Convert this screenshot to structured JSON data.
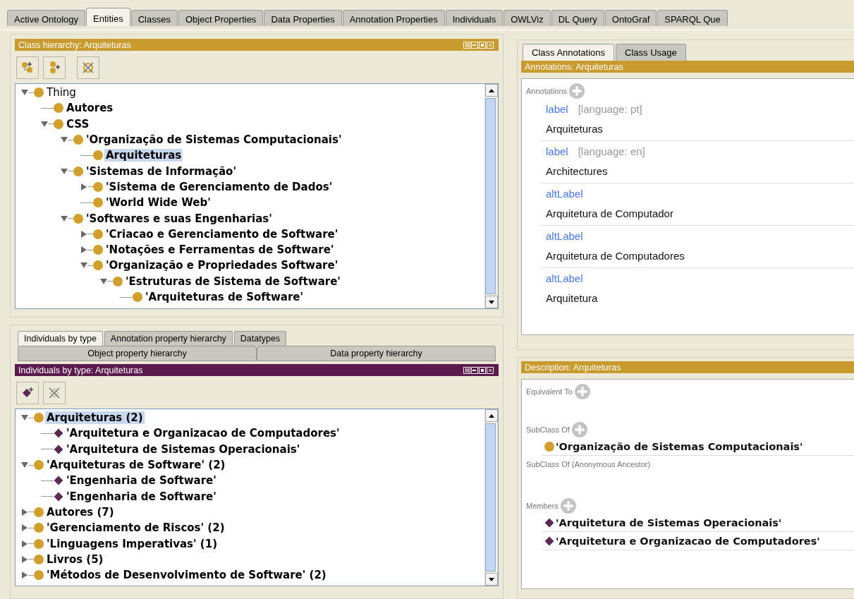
{
  "main_tabs": [
    {
      "label": "Active Ontology",
      "selected": false
    },
    {
      "label": "Entities",
      "selected": true
    },
    {
      "label": "Classes",
      "selected": false
    },
    {
      "label": "Object Properties",
      "selected": false
    },
    {
      "label": "Data Properties",
      "selected": false
    },
    {
      "label": "Annotation Properties",
      "selected": false
    },
    {
      "label": "Individuals",
      "selected": false
    },
    {
      "label": "OWLViz",
      "selected": false
    },
    {
      "label": "DL Query",
      "selected": false
    },
    {
      "label": "OntoGraf",
      "selected": false
    },
    {
      "label": "SPARQL Que",
      "selected": false
    }
  ],
  "class_hierarchy": {
    "title": "Class hierarchy: Arquiteturas",
    "kind": "class",
    "tree": [
      {
        "name": "Thing",
        "kind": "thing",
        "expandable": true,
        "expanded": true,
        "selected": false,
        "children": [
          {
            "name": "Autores",
            "kind": "class",
            "expandable": false,
            "selected": false
          },
          {
            "name": "CSS",
            "kind": "class",
            "expandable": true,
            "expanded": true,
            "selected": false,
            "children": [
              {
                "name": "'Organização de Sistemas Computacionais'",
                "kind": "class",
                "expandable": true,
                "expanded": true,
                "selected": false,
                "children": [
                  {
                    "name": "Arquiteturas",
                    "kind": "class",
                    "expandable": false,
                    "selected": true
                  }
                ]
              },
              {
                "name": "'Sistemas de Informação'",
                "kind": "class",
                "expandable": true,
                "expanded": true,
                "selected": false,
                "children": [
                  {
                    "name": "'Sistema de Gerenciamento de Dados'",
                    "kind": "class",
                    "expandable": true,
                    "expanded": false,
                    "selected": false
                  },
                  {
                    "name": "'World Wide Web'",
                    "kind": "class",
                    "expandable": false,
                    "selected": false
                  }
                ]
              },
              {
                "name": "'Softwares e suas Engenharias'",
                "kind": "class",
                "expandable": true,
                "expanded": true,
                "selected": false,
                "children": [
                  {
                    "name": "'Criacao e Gerenciamento de Software'",
                    "kind": "class",
                    "expandable": true,
                    "expanded": false,
                    "selected": false
                  },
                  {
                    "name": "'Notações e Ferramentas de Software'",
                    "kind": "class",
                    "expandable": true,
                    "expanded": false,
                    "selected": false
                  },
                  {
                    "name": "'Organização e Propriedades Software'",
                    "kind": "class",
                    "expandable": true,
                    "expanded": true,
                    "selected": false,
                    "children": [
                      {
                        "name": "'Estruturas de Sistema de Software'",
                        "kind": "class",
                        "expandable": true,
                        "expanded": true,
                        "selected": false,
                        "children": [
                          {
                            "name": "'Arquiteturas de Software'",
                            "kind": "class",
                            "expandable": false,
                            "selected": false
                          }
                        ]
                      }
                    ]
                  }
                ]
              }
            ]
          }
        ]
      }
    ]
  },
  "lower_tabs_row_1": [
    {
      "label": "Individuals by type",
      "selected": true
    },
    {
      "label": "Annotation property hierarchy",
      "selected": false
    },
    {
      "label": "Datatypes",
      "selected": false
    }
  ],
  "lower_tabs_row_2": [
    {
      "label": "Object property hierarchy",
      "selected": false
    },
    {
      "label": "Data property hierarchy",
      "selected": false
    }
  ],
  "individuals_by_type": {
    "title": "Individuals by type: Arquiteturas",
    "kind": "individual",
    "tree": [
      {
        "name": "Arquiteturas (2)",
        "kind": "class",
        "expandable": true,
        "expanded": true,
        "selected": true,
        "children": [
          {
            "name": "'Arquitetura e Organizacao de Computadores'",
            "kind": "individual",
            "expandable": false,
            "selected": false
          },
          {
            "name": "'Arquitetura de Sistemas Operacionais'",
            "kind": "individual",
            "expandable": false,
            "selected": false
          }
        ]
      },
      {
        "name": "'Arquiteturas de Software' (2)",
        "kind": "class",
        "expandable": true,
        "expanded": true,
        "selected": false,
        "children": [
          {
            "name": "'Engenharia de Software'",
            "kind": "individual",
            "expandable": false,
            "selected": false
          },
          {
            "name": "'Engenharia de Software'",
            "kind": "individual",
            "expandable": false,
            "selected": false
          }
        ]
      },
      {
        "name": "Autores (7)",
        "kind": "class",
        "expandable": true,
        "expanded": false,
        "selected": false
      },
      {
        "name": "'Gerenciamento de Riscos' (2)",
        "kind": "class",
        "expandable": true,
        "expanded": false,
        "selected": false
      },
      {
        "name": "'Linguagens Imperativas' (1)",
        "kind": "class",
        "expandable": true,
        "expanded": false,
        "selected": false
      },
      {
        "name": "Livros (5)",
        "kind": "class",
        "expandable": true,
        "expanded": false,
        "selected": false
      },
      {
        "name": "'Métodos de Desenvolvimento de Software' (2)",
        "kind": "class",
        "expandable": true,
        "expanded": false,
        "selected": false
      }
    ]
  },
  "right_tabs": [
    {
      "label": "Class Annotations",
      "selected": true
    },
    {
      "label": "Class Usage",
      "selected": false
    }
  ],
  "annotations": {
    "title": "Annotations: Arquiteturas",
    "heading": "Annotations",
    "items": [
      {
        "property": "label",
        "language": "[language: pt]",
        "value": "Arquiteturas"
      },
      {
        "property": "label",
        "language": "[language: en]",
        "value": "Architectures"
      },
      {
        "property": "altLabel",
        "value": "Arquitetura de Computador"
      },
      {
        "property": "altLabel",
        "value": "Arquitetura de Computadores"
      },
      {
        "property": "altLabel",
        "value": "Arquitetura"
      }
    ]
  },
  "description": {
    "title": "Description: Arquiteturas",
    "sections": [
      {
        "title": "Equivalent To",
        "add_button": true
      },
      {
        "title": "SubClass Of",
        "add_button": true,
        "items": [
          {
            "kind": "class",
            "name": "'Organização de Sistemas Computacionais'"
          }
        ]
      },
      {
        "title": "SubClass Of (Anonymous Ancestor)",
        "add_button": false
      },
      {
        "title": "Members",
        "add_button": true,
        "items": [
          {
            "kind": "individual",
            "name": "'Arquitetura de Sistemas Operacionais'"
          },
          {
            "kind": "individual",
            "name": "'Arquitetura e Organizacao de Computadores'"
          }
        ]
      }
    ]
  }
}
